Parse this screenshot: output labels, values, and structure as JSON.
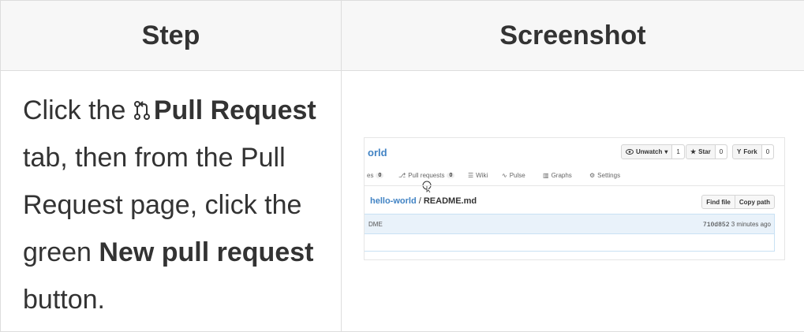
{
  "table": {
    "headers": {
      "step": "Step",
      "screenshot": "Screenshot"
    },
    "step_text": {
      "part1": "Click the ",
      "pr_label_bold": "Pull Request",
      "part2": " tab, then from the Pull Request page, click the green ",
      "button_bold": "New pull request",
      "part3": " button."
    }
  },
  "screenshot": {
    "repo_name": "orld",
    "buttons": {
      "unwatch": {
        "label": "Unwatch",
        "count": "1"
      },
      "star": {
        "label": "Star",
        "count": "0"
      },
      "fork": {
        "label": "Fork",
        "count": "0"
      }
    },
    "tabs": [
      {
        "label": "es",
        "count": "0"
      },
      {
        "label": "Pull requests",
        "count": "0"
      },
      {
        "label": "Wiki"
      },
      {
        "label": "Pulse"
      },
      {
        "label": "Graphs"
      },
      {
        "label": "Settings"
      }
    ],
    "breadcrumb": {
      "repo": "hello-world",
      "separator": "/",
      "file": "README.md"
    },
    "file_buttons": {
      "find_file": "Find file",
      "copy_path": "Copy path"
    },
    "commit": {
      "message": "DME",
      "sha": "710d852",
      "time": "3 minutes ago"
    }
  }
}
